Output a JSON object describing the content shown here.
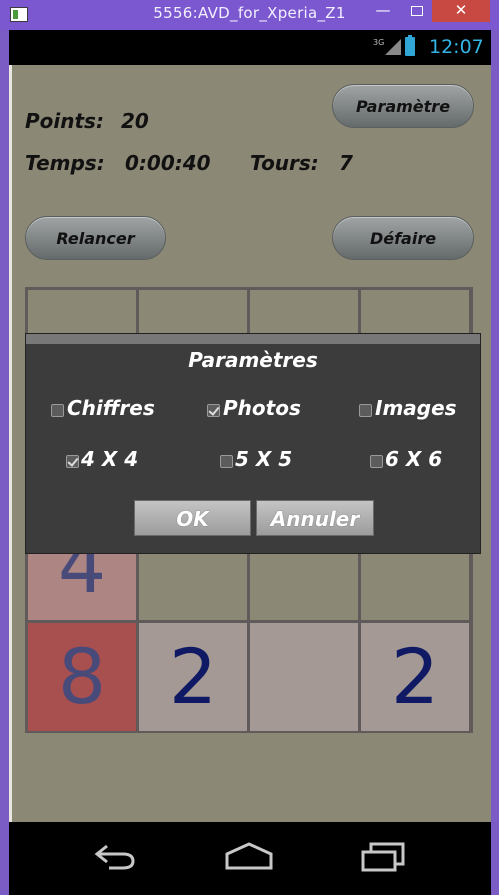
{
  "window": {
    "title": "5556:AVD_for_Xperia_Z1",
    "minimize_glyph": "—",
    "close_glyph": "✕"
  },
  "statusbar": {
    "network": "3G",
    "time": "12:07",
    "accent_color": "#33b5e5"
  },
  "toolbar": {
    "settings_button": "Paramètre",
    "restart_button": "Relancer",
    "undo_button": "Défaire"
  },
  "stats": {
    "points_label": "Points:",
    "points_value": "20",
    "time_label": "Temps:",
    "time_value": "0:00:40",
    "turns_label": "Tours:",
    "turns_value": "7"
  },
  "board": {
    "visible_numbers": {
      "r3c0": "4",
      "r4c0": "8",
      "r4c1": "2",
      "r4c3": "2"
    }
  },
  "dialog": {
    "title": "Paramètres",
    "type_options": [
      {
        "label": "Chiffres",
        "checked": false
      },
      {
        "label": "Photos",
        "checked": true
      },
      {
        "label": "Images",
        "checked": false
      }
    ],
    "size_options": [
      {
        "label": "4 X 4",
        "checked": true
      },
      {
        "label": "5 X 5",
        "checked": false
      },
      {
        "label": "6 X 6",
        "checked": false
      }
    ],
    "ok_button": "OK",
    "cancel_button": "Annuler"
  },
  "navbar": {
    "icons": [
      "back-icon",
      "home-icon",
      "recent-apps-icon"
    ]
  }
}
